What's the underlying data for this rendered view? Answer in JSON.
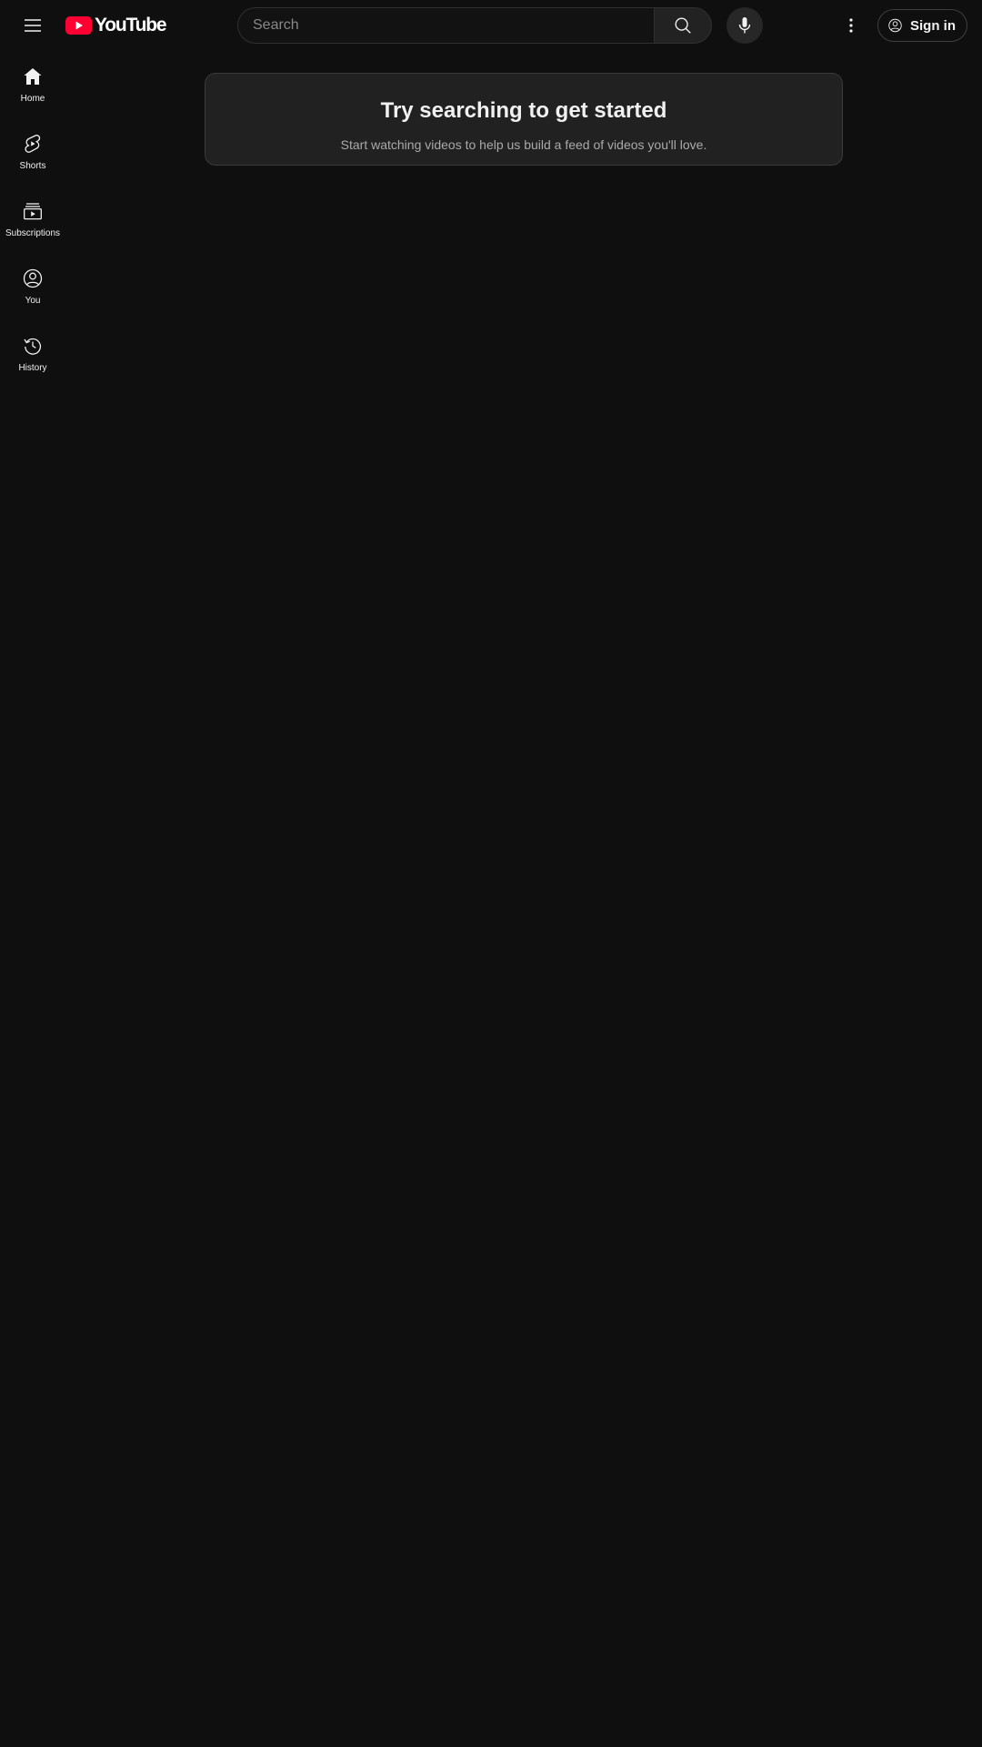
{
  "masthead": {
    "logo_text": "YouTube",
    "search": {
      "placeholder": "Search",
      "value": ""
    },
    "signin_label": "Sign in"
  },
  "guide": {
    "items": [
      {
        "label": "Home",
        "icon": "home-icon"
      },
      {
        "label": "Shorts",
        "icon": "shorts-icon"
      },
      {
        "label": "Subscriptions",
        "icon": "subscriptions-icon"
      },
      {
        "label": "You",
        "icon": "account-circle-icon"
      },
      {
        "label": "History",
        "icon": "history-icon"
      }
    ]
  },
  "feed": {
    "empty_title": "Try searching to get started",
    "empty_subtitle": "Start watching videos to help us build a feed of videos you'll love."
  },
  "colors": {
    "background": "#0f0f0f",
    "brand_red": "#ff0033",
    "card": "#212121",
    "text_primary": "#f1f1f1",
    "text_secondary": "#aaaaaa"
  }
}
